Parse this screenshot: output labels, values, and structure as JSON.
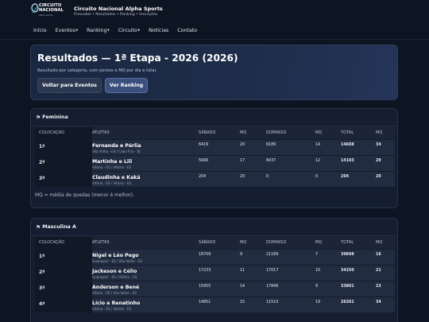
{
  "brand": {
    "logo_text_1": "CIRCUITO",
    "logo_text_2": "NACIONAL",
    "logo_sub": "alpha sports",
    "title": "Circuito Nacional Alpha Sports",
    "subtitle": "Frescobol • Resultados • Ranking • Inscrições"
  },
  "nav": {
    "inicio": "Início",
    "eventos": "Eventos",
    "ranking": "Ranking",
    "circuito": "Circuito",
    "noticias": "Notícias",
    "contato": "Contato"
  },
  "hero": {
    "title": "Resultados — 1ª Etapa - 2026 (2026)",
    "description": "Resultado por categoria, com pontos e MQ por dia e total.",
    "back_button": "Voltar para Eventos",
    "ranking_button": "Ver Ranking"
  },
  "columns": {
    "colocacao": "COLOCAÇÃO",
    "atletas": "ATLETAS",
    "sabado": "SÁBADO",
    "mq1": "MQ",
    "domingo": "DOMINGO",
    "mq2": "MQ",
    "total": "TOTAL",
    "mq3": "MQ"
  },
  "feminina": {
    "title": "Feminina",
    "note": "MQ = média de quedas (menor é melhor).",
    "rows": [
      {
        "pos": "1º",
        "team": "Fernanda e Pérlia",
        "loc": "Vila Velha - ES / Cabo Frio - RJ",
        "sab": "6419",
        "mq1": "20",
        "dom": "8189",
        "mq2": "14",
        "total": "14608",
        "mq3": "34"
      },
      {
        "pos": "2º",
        "team": "Martinha e Lili",
        "loc": "Vitória - ES / Vitória - ES",
        "sab": "5666",
        "mq1": "17",
        "dom": "8437",
        "mq2": "12",
        "total": "14103",
        "mq3": "29"
      },
      {
        "pos": "3º",
        "team": "Claudinha e Kaká",
        "loc": "Vitória - ES / Vitória - ES",
        "sab": "204",
        "mq1": "20",
        "dom": "0",
        "mq2": "0",
        "total": "204",
        "mq3": "20"
      }
    ]
  },
  "masculina": {
    "title": "Masculina A",
    "rows": [
      {
        "pos": "1º",
        "team": "Nigel e Léo Pego",
        "loc": "Guarapari - ES / Vila Velha - ES",
        "sab": "18709",
        "mq1": "9",
        "dom": "21189",
        "mq2": "7",
        "total": "39898",
        "mq3": "16"
      },
      {
        "pos": "2º",
        "team": "Jackeson e Célio",
        "loc": "Guarapari - ES / Vitória - ES",
        "sab": "17233",
        "mq1": "11",
        "dom": "17017",
        "mq2": "10",
        "total": "34250",
        "mq3": "21"
      },
      {
        "pos": "3º",
        "team": "Anderson e Bené",
        "loc": "Vitória - ES / Vila Velha - ES",
        "sab": "15955",
        "mq1": "14",
        "dom": "17846",
        "mq2": "9",
        "total": "33801",
        "mq3": "23"
      },
      {
        "pos": "4º",
        "team": "Lício e Renatinho",
        "loc": "Vitória - ES / Vitória - ES",
        "sab": "14851",
        "mq1": "15",
        "dom": "11510",
        "mq2": "19",
        "total": "26361",
        "mq3": "34"
      }
    ]
  }
}
